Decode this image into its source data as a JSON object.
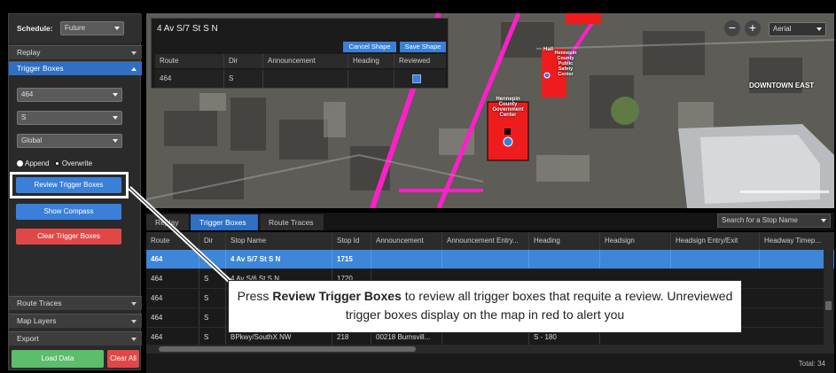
{
  "sidebar": {
    "schedule_label": "Schedule:",
    "schedule_value": "Future",
    "sections": {
      "replay": "Replay",
      "trigger_boxes": "Trigger Boxes",
      "route_traces": "Route Traces",
      "map_layers": "Map Layers",
      "export": "Export"
    },
    "route_select": "464",
    "dir_select": "S",
    "scope_select": "Global",
    "append_label": "Append",
    "overwrite_label": "Overwrite",
    "review_button": "Review Trigger Boxes",
    "compass_button": "Show Compass",
    "clear_button": "Clear Trigger Boxes",
    "load_button": "Load Data",
    "clear_all_button": "Clear All"
  },
  "popup": {
    "title": "4 Av S/7 St S N",
    "cancel_label": "Cancel Shape",
    "save_label": "Save Shape",
    "headers": [
      "Route",
      "Dir",
      "Announcement",
      "Heading",
      "Reviewed"
    ],
    "row": [
      "464",
      "S",
      "",
      "",
      ""
    ]
  },
  "map": {
    "aerial_label": "Aerial",
    "labels": {
      "downtown": "DOWNTOWN EAST",
      "hennepin": "Hennepin County Government Center",
      "safety": "Hennepin County Public Safety Center",
      "hall": "Hall"
    }
  },
  "tabs": [
    "Replay",
    "Trigger Boxes",
    "Route Traces"
  ],
  "search_placeholder": "Search for a Stop Name",
  "grid": {
    "columns": [
      "Route",
      "Dir",
      "Stop Name",
      "Stop Id",
      "Announcement",
      "Announcement Entry...",
      "Heading",
      "Headsign",
      "Headsign Entry/Exit",
      "Headway Timep..."
    ],
    "rows": [
      [
        "464",
        "",
        "4 Av S/7 St S N",
        "1715",
        "",
        "",
        "",
        "",
        "",
        ""
      ],
      [
        "464",
        "S",
        "4 Av S/6 St S N",
        "1720",
        "",
        "",
        "",
        "",
        "",
        ""
      ],
      [
        "464",
        "S",
        "",
        "",
        "",
        "",
        "",
        "",
        "",
        ""
      ],
      [
        "464",
        "S",
        "",
        "",
        "",
        "",
        "",
        "",
        "",
        ""
      ],
      [
        "464",
        "S",
        "BPkwy/SouthX NW",
        "218",
        "00218 Burnsvill...",
        "",
        "S - 180",
        "",
        "",
        ""
      ]
    ],
    "total": "Total: 34"
  },
  "callout": {
    "pre": "Press ",
    "bold": "Review Trigger Boxes",
    "post": " to review all trigger boxes that requite a review. Unreviewed trigger boxes display on the map in red to alert you"
  }
}
